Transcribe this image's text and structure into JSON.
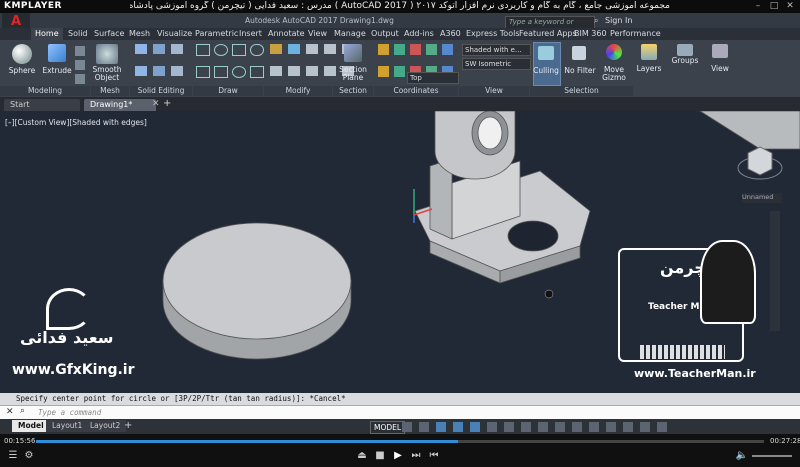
{
  "player": {
    "name": "KMPLAYER",
    "caption": "مجموعه آموزشی جامع ، گام به گام و کاربردی نرم افزار  اتوکد  ۲۰۱۷ ( AutoCAD 2017 )   مدرس : سعید فدایی ( تیچرمن ) گروه آموزشی پادشاه گرافیست ها",
    "time_current": "00:15:56",
    "time_total": "00:27:28",
    "progress": 0.58
  },
  "acad": {
    "logo": "A",
    "window_title": "Autodesk AutoCAD 2017   Drawing1.dwg",
    "search_placeholder": "Type a keyword or phrase",
    "signin": "Sign In"
  },
  "ribbon_tabs": [
    "Home",
    "Solid",
    "Surface",
    "Mesh",
    "Visualize",
    "Parametric",
    "Insert",
    "Annotate",
    "View",
    "Manage",
    "Output",
    "Add-ins",
    "A360",
    "Express Tools",
    "Featured Apps",
    "BIM 360",
    "Performance"
  ],
  "ribbon": {
    "sphere": "Sphere",
    "extrude": "Extrude",
    "smooth_object": "Smooth Object",
    "section_plane": "Section Plane",
    "visual_style": "Shaded with e...",
    "view_preset": "SW Isometric",
    "ucs_view": "Top",
    "culling": "Culling",
    "no_filter": "No Filter",
    "move_gizmo": "Move Gizmo",
    "layers": "Layers",
    "groups": "Groups",
    "view": "View"
  },
  "panels": [
    "Modeling",
    "Mesh",
    "Solid Editing",
    "Draw",
    "Modify",
    "Section",
    "Coordinates",
    "View",
    "Selection"
  ],
  "file_tabs": [
    "Start",
    "Drawing1*"
  ],
  "viewport": {
    "label": "[–][Custom View][Shaded with edges]",
    "navcube_label": "Unnamed"
  },
  "command": {
    "history": "Specify center point for circle or [3P/2P/Ttr (tan tan radius)]: *Cancel*",
    "placeholder": "Type a command"
  },
  "layout_tabs": [
    "Model",
    "Layout1",
    "Layout2"
  ],
  "status": {
    "model": "MODEL"
  },
  "watermark": {
    "author_fa": "سعید فدائی",
    "left_url": "www.GfxKing.ir",
    "brand_fa": "تیچرمن",
    "brand_en": "Teacher Man",
    "right_url": "www.TeacherMan.ir"
  },
  "colors": {
    "viewport_bg": "#222936",
    "ribbon_bg": "#3c424c",
    "accent": "#2e8ed8"
  }
}
